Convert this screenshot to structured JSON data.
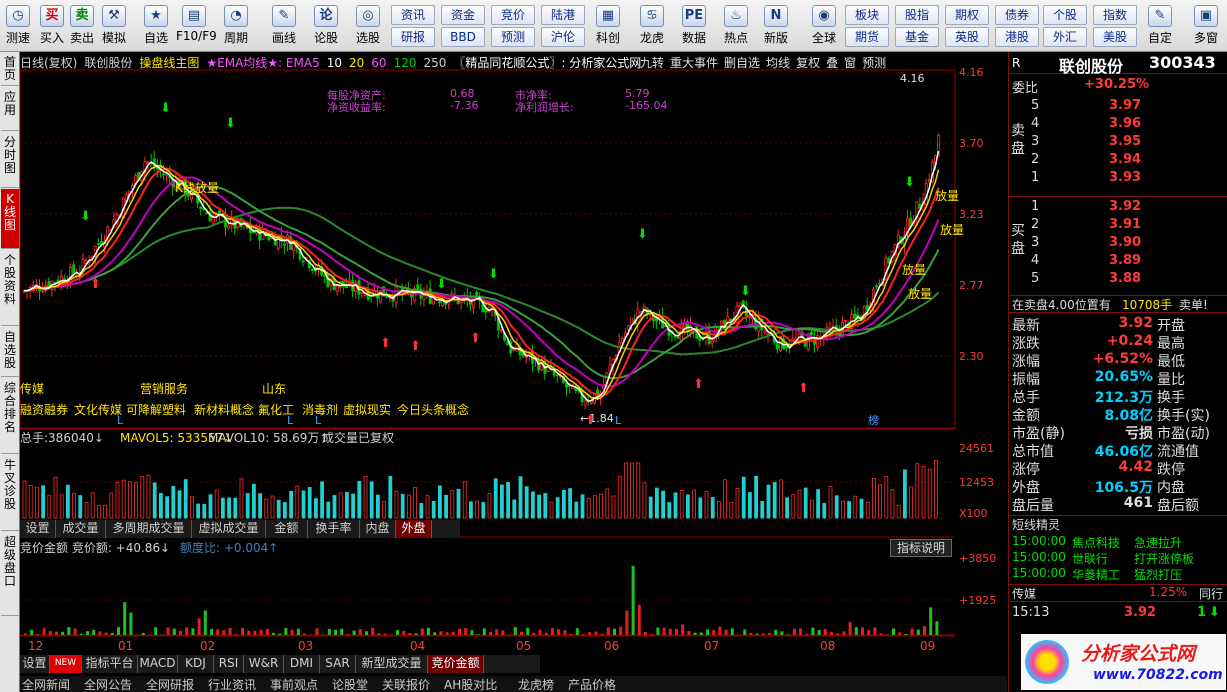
{
  "toolbar": [
    {
      "label": "测速",
      "icon": "◷"
    },
    {
      "label": "买入",
      "icon": "买"
    },
    {
      "label": "卖出",
      "icon": "卖"
    },
    {
      "label": "模拟",
      "icon": "⚒"
    },
    {
      "label": "自选",
      "icon": "★"
    },
    {
      "label": "F10/F9",
      "icon": "▤"
    },
    {
      "label": "周期",
      "icon": "◔"
    },
    {
      "label": "画线",
      "icon": "✎"
    },
    {
      "label": "论股",
      "icon": "论"
    },
    {
      "label": "选股",
      "icon": "◎"
    },
    {
      "label": "科创",
      "icon": "▦"
    },
    {
      "label": "龙虎",
      "icon": "♋"
    },
    {
      "label": "数据",
      "icon": "PE"
    },
    {
      "label": "热点",
      "icon": "♨"
    },
    {
      "label": "新版",
      "icon": "N"
    },
    {
      "label": "全球",
      "icon": "◉"
    },
    {
      "label": "自定",
      "icon": "✎"
    },
    {
      "label": "多窗",
      "icon": "▣"
    }
  ],
  "small_buttons": [
    "资讯",
    "资金",
    "竞价",
    "陆港",
    "研报",
    "BBD",
    "预测",
    "沪伦",
    "板块",
    "股指",
    "期权",
    "债券",
    "英股",
    "港股",
    "个股",
    "指数",
    "期货",
    "基金",
    "外汇",
    "美股"
  ],
  "left_nav": [
    "首页",
    "应用",
    "分时图",
    "K线图",
    "个股资料",
    "自选股",
    "综合排名",
    "牛叉诊股",
    "超级盘口"
  ],
  "chart": {
    "title_items": [
      "日线(复权)",
      "联创股份",
      "操盘线主图",
      "★EMA均线★: EMA5",
      "10",
      "20",
      "60",
      "120",
      "250",
      "〖精品同花顺公式〗: 分析家公式网"
    ],
    "right_buttons": [
      "九转",
      "重大事件",
      "删自选",
      "均线",
      "复权",
      "叠",
      "窗",
      "预测"
    ],
    "fin": {
      "a_l": "每股净资产:",
      "a_v": "0.68",
      "b_l": "净资收益率:",
      "b_v": "-7.36",
      "c_l": "市净率:",
      "c_v": "5.79",
      "d_l": "净利润增长:",
      "d_v": "-165.04"
    },
    "price_ticks": [
      "4.16",
      "3.70",
      "3.23",
      "2.77",
      "2.30"
    ],
    "high_label": "4.16",
    "low_label": "1.84",
    "annotations": [
      "K线放量",
      "放量",
      "放量",
      "放量",
      "放量"
    ],
    "concept_row1": [
      "传媒",
      "营销服务",
      "山东"
    ],
    "concept_row2": [
      "融资融券",
      "文化传媒",
      "可降解塑料",
      "新材料概念",
      "氟化工",
      "消毒剂",
      "虚拟现实",
      "今日头条概念"
    ],
    "markers": [
      "L",
      "L",
      "L",
      "L",
      "榜"
    ],
    "volume": {
      "total_l": "总手:",
      "total_v": "386040",
      "ma5_l": "MAVOL5:",
      "ma5_v": "533557",
      "ma10_l": "MAVOL10:",
      "ma10_v": "58.69万",
      "note": "成交量已复权",
      "ticks": [
        "24561",
        "12453",
        "X100"
      ]
    },
    "vol_tabs": [
      "设置",
      "成交量",
      "多周期成交量",
      "虚拟成交量",
      "金额",
      "换手率",
      "内盘",
      "外盘"
    ],
    "auction": {
      "title": "竞价金额",
      "amt_l": "竞价额:",
      "amt_v": "+40.86",
      "ratio_l": "额度比:",
      "ratio_v": "+0.004",
      "btn": "指标说明",
      "ticks": [
        "+3850",
        "+1925"
      ]
    },
    "xaxis": [
      "12",
      "01",
      "02",
      "03",
      "04",
      "05",
      "06",
      "07",
      "08",
      "09"
    ],
    "bottom_tabs": [
      "设置",
      "NEW",
      "指标平台",
      "MACD",
      "KDJ",
      "RSI",
      "W&R",
      "DMI",
      "SAR",
      "新型成交量",
      "竞价金额"
    ],
    "bottom_tabs2": [
      "全网新闻",
      "全网公告",
      "全网研报",
      "行业资讯",
      "事前观点",
      "论股堂",
      "关联报价",
      "AH股对比",
      "龙虎榜",
      "产品价格"
    ]
  },
  "quote": {
    "name": "联创股份",
    "code": "300343",
    "weibi_l": "委比",
    "weibi_v": "+30.25%",
    "sell_l": "卖盘",
    "buy_l": "买盘",
    "asks": [
      [
        "5",
        "3.97"
      ],
      [
        "4",
        "3.96"
      ],
      [
        "3",
        "3.95"
      ],
      [
        "2",
        "3.94"
      ],
      [
        "1",
        "3.93"
      ]
    ],
    "bids": [
      [
        "1",
        "3.92"
      ],
      [
        "2",
        "3.91"
      ],
      [
        "3",
        "3.90"
      ],
      [
        "4",
        "3.89"
      ],
      [
        "5",
        "3.88"
      ]
    ],
    "note": "在卖盘4.00位置有",
    "note_vol": "10708手",
    "note_end": "卖单!",
    "stats": [
      [
        "最新",
        "3.92",
        "开盘",
        ""
      ],
      [
        "涨跌",
        "+0.24",
        "最高",
        ""
      ],
      [
        "涨幅",
        "+6.52%",
        "最低",
        ""
      ],
      [
        "振幅",
        "20.65%",
        "量比",
        ""
      ],
      [
        "总手",
        "212.3万",
        "换手",
        ""
      ],
      [
        "金额",
        "8.08亿",
        "换手(实)",
        ""
      ],
      [
        "市盈(静)",
        "亏损",
        "市盈(动)",
        ""
      ],
      [
        "总市值",
        "46.06亿",
        "流通值",
        ""
      ],
      [
        "涨停",
        "4.42",
        "跌停",
        ""
      ],
      [
        "外盘",
        "106.5万",
        "内盘",
        ""
      ],
      [
        "盘后量",
        "461",
        "盘后额",
        ""
      ]
    ],
    "elf_title": "短线精灵",
    "elf": [
      [
        "15:00:00",
        "焦点科技",
        "急速拉升"
      ],
      [
        "15:00:00",
        "世联行",
        "打开涨停板"
      ],
      [
        "15:00:00",
        "华菱精工",
        "猛烈打压"
      ]
    ],
    "sector": "传媒",
    "sector_pct": "1.25%",
    "sector_more": "同行",
    "tick_time": "15:13",
    "tick_price": "3.92",
    "tick_vol": "1",
    "logo": "分析家公式网",
    "site": "www.70822.com"
  }
}
